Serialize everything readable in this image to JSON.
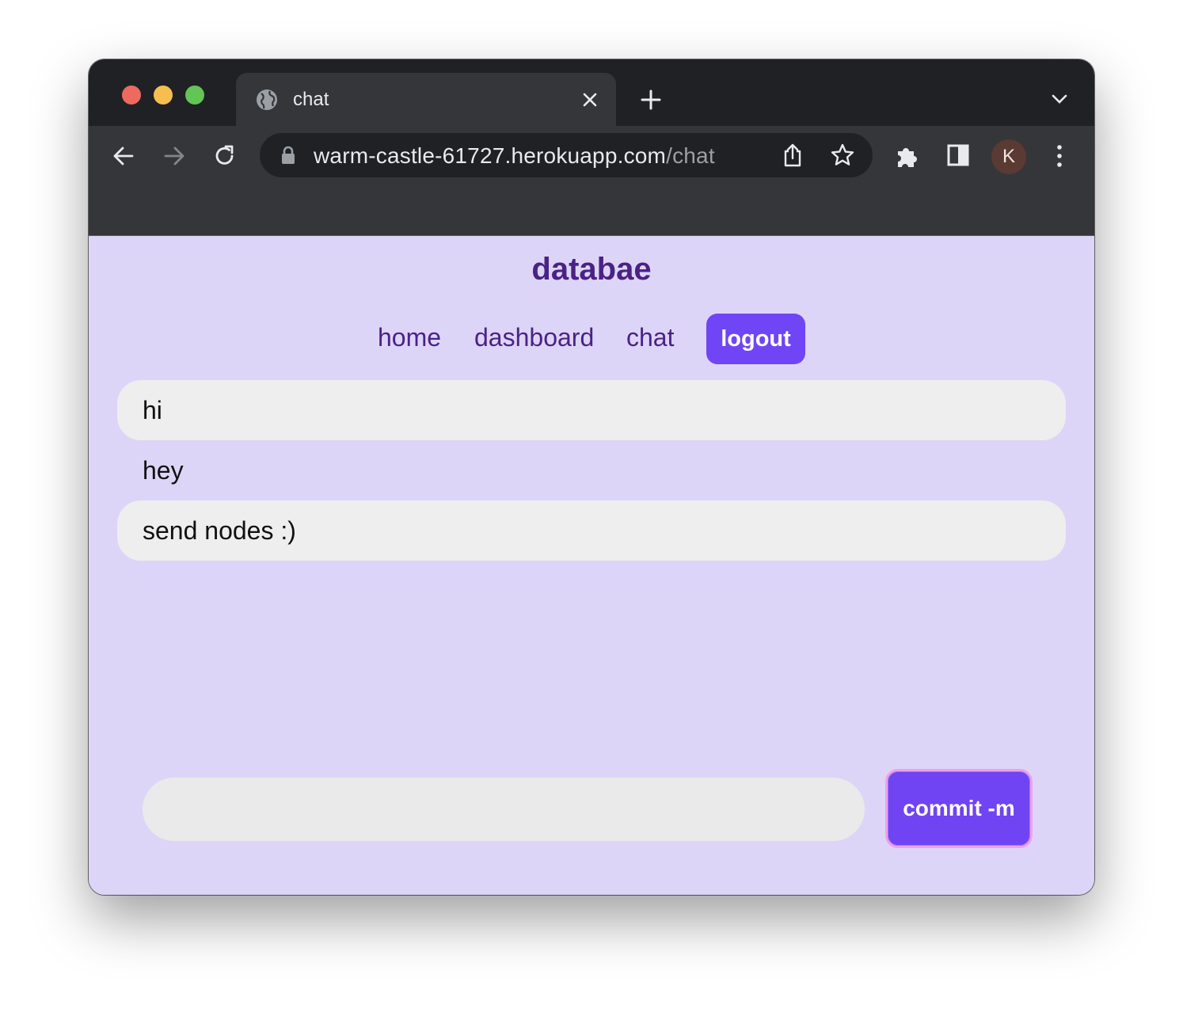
{
  "browser": {
    "tab_title": "chat",
    "url_host": "warm-castle-61727.herokuapp.com",
    "url_path": "/chat",
    "profile_initial": "K"
  },
  "app": {
    "brand": "databae",
    "nav": {
      "home": "home",
      "dashboard": "dashboard",
      "chat": "chat",
      "logout": "logout"
    }
  },
  "messages": [
    {
      "text": "hi",
      "shaded": true
    },
    {
      "text": "hey",
      "shaded": false
    },
    {
      "text": "send nodes :)",
      "shaded": true
    }
  ],
  "composer": {
    "value": "",
    "placeholder": "",
    "submit_label": "commit -m"
  },
  "colors": {
    "page_bg": "#ddd5f8",
    "accent": "#7045f5",
    "brand_text": "#4a2286",
    "message_bg": "#eeeeee"
  },
  "icons": [
    "globe-icon",
    "close-icon",
    "plus-icon",
    "chevron-down-icon",
    "back-arrow-icon",
    "forward-arrow-icon",
    "reload-icon",
    "lock-icon",
    "share-icon",
    "star-icon",
    "puzzle-icon",
    "side-panel-icon",
    "kebab-menu-icon"
  ]
}
